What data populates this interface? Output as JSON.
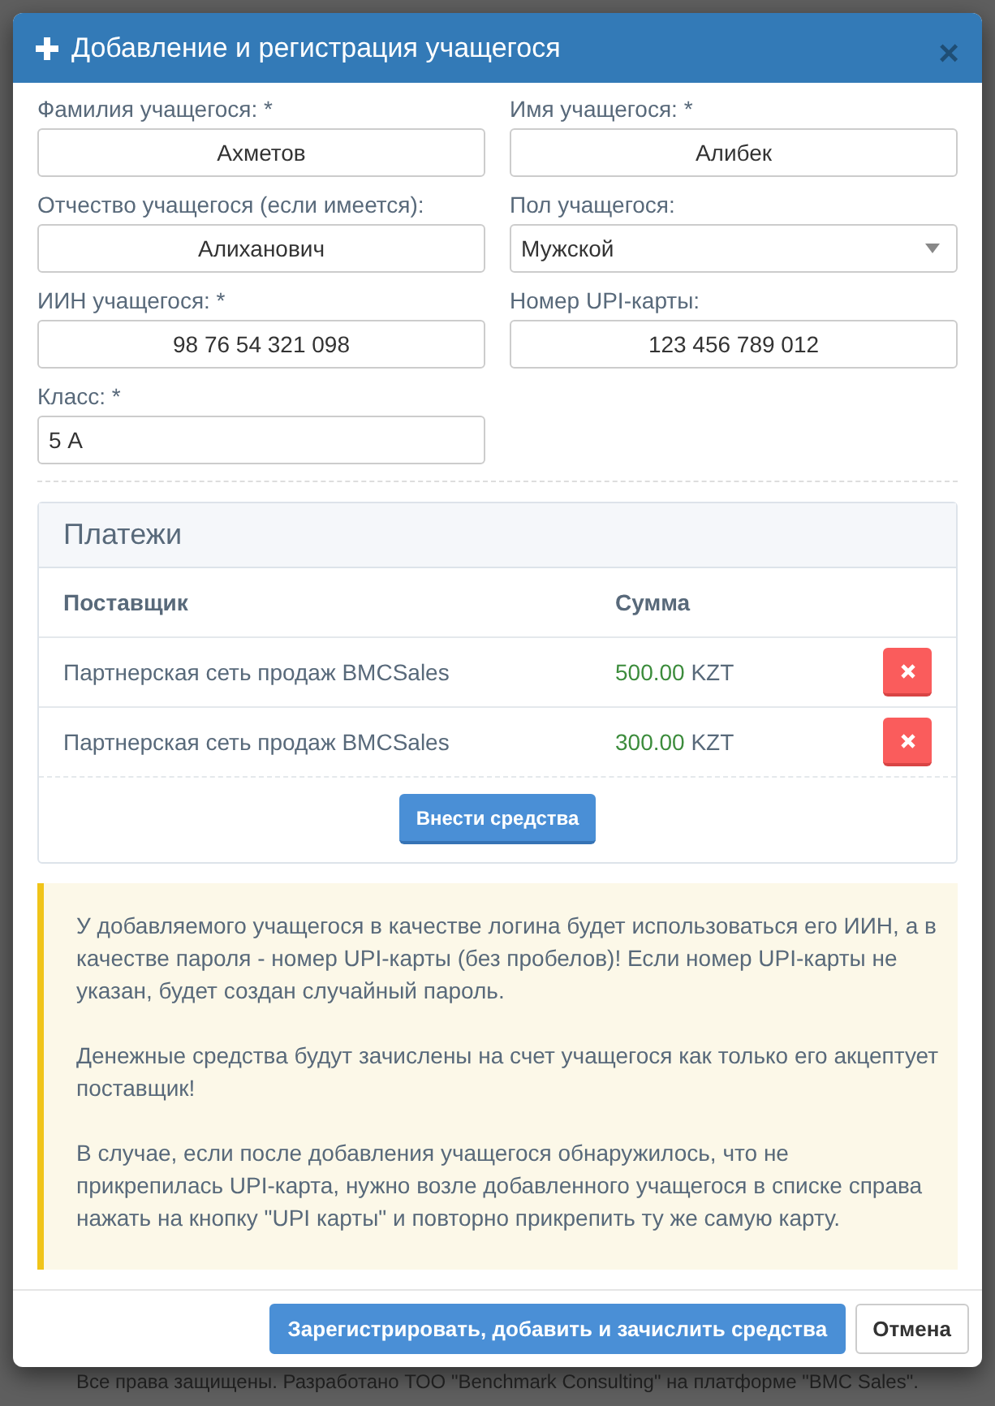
{
  "modal": {
    "title": "Добавление и регистрация учащегося",
    "close": "×"
  },
  "fields": [
    {
      "label": "Фамилия учащегося: *",
      "value": "Ахметов",
      "kind": "centered"
    },
    {
      "label": "Имя учащегося: *",
      "value": "Алибек",
      "kind": "centered"
    },
    {
      "label": "Отчество учащегося (если имеется):",
      "value": "Алиханович",
      "kind": "centered"
    },
    {
      "label": "Пол учащегося:",
      "value": "Мужской",
      "kind": "select"
    },
    {
      "label": "ИИН учащегося: *",
      "value": "98 76 54 321 098",
      "kind": "centered"
    },
    {
      "label": "Номер UPI-карты:",
      "value": "123 456 789 012",
      "kind": "centered"
    },
    {
      "label": "Класс: *",
      "value": "5 А",
      "kind": "plain"
    }
  ],
  "payments": {
    "title": "Платежи",
    "columns": [
      "Поставщик",
      "Сумма"
    ],
    "rows": [
      {
        "supplier": "Партнерская сеть продаж BMCSales",
        "amount": "500.00",
        "currency": "KZT"
      },
      {
        "supplier": "Партнерская сеть продаж BMCSales",
        "amount": "300.00",
        "currency": "KZT"
      }
    ],
    "add_button": "Внести средства"
  },
  "notice": [
    "У добавляемого учащегося в качестве логина будет использоваться его ИИН, а в качестве пароля - номер UPI-карты (без пробелов)! Если номер UPI-карты не указан, будет создан случайный пароль.",
    "Денежные средства будут зачислены на счет учащегося как только его акцептует поставщик!",
    "В случае, если после добавления учащегося обнаружилось, что не прикрепилась UPI-карта, нужно возле добавленного учащегося в списке справа нажать на кнопку \"UPI карты\" и повторно прикрепить ту же самую карту."
  ],
  "buttons": [
    {
      "label": "Зарегистрировать, добавить и зачислить средства",
      "kind": "primary"
    },
    {
      "label": "Отмена",
      "kind": "default"
    }
  ],
  "page_footer": "Все права защищены. Разработано ТОО \"Benchmark Consulting\" на платформе \"BMC Sales\"."
}
